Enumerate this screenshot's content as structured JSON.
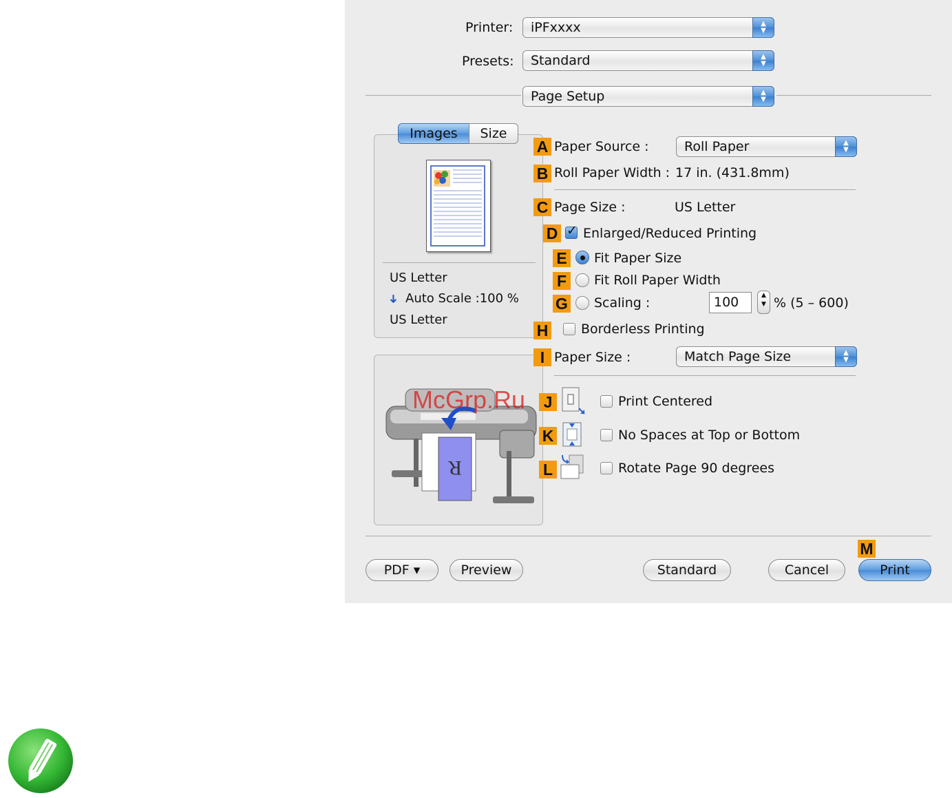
{
  "header": {
    "printer_label": "Printer:",
    "printer_value": "iPFxxxx",
    "presets_label": "Presets:",
    "presets_value": "Standard",
    "panel_value": "Page Setup"
  },
  "tabs": [
    {
      "label": "Images",
      "active": true
    },
    {
      "label": "Size",
      "active": false
    }
  ],
  "preview_info": {
    "line1": "US Letter",
    "scale_arrow": "➜",
    "line2": "Auto Scale :100 %",
    "line3": "US Letter"
  },
  "markers": [
    "A",
    "B",
    "C",
    "D",
    "E",
    "F",
    "G",
    "H",
    "I",
    "J",
    "K",
    "L",
    "M"
  ],
  "settings": {
    "paper_source_label": "Paper Source :",
    "paper_source_value": "Roll Paper",
    "roll_width_label": "Roll Paper Width :",
    "roll_width_value": "17 in. (431.8mm)",
    "page_size_label": "Page Size :",
    "page_size_value": "US Letter",
    "enlarged_label": "Enlarged/Reduced Printing",
    "enlarged_checked": true,
    "fit_paper_label": "Fit Paper Size",
    "fit_roll_label": "Fit Roll Paper Width",
    "scaling_label": "Scaling :",
    "scaling_value": "100",
    "scaling_range": "% (5 – 600)",
    "borderless_label": "Borderless Printing",
    "paper_size_label": "Paper Size :",
    "paper_size_value": "Match Page Size",
    "print_centered_label": "Print Centered",
    "no_spaces_label": "No Spaces at Top or Bottom",
    "rotate_label": "Rotate Page 90 degrees"
  },
  "watermark": "McGrp.Ru",
  "footer": {
    "pdf_label": "PDF ▾",
    "preview_label": "Preview",
    "standard_label": "Standard",
    "cancel_label": "Cancel",
    "print_label": "Print"
  },
  "colors": {
    "accent": "#3e85d4",
    "marker": "#f39b10",
    "note_icon": "#33b633"
  },
  "icons": [
    "updown-arrows-icon",
    "page-preview-icon",
    "printer-illustration",
    "print-centered-icon",
    "no-spaces-icon",
    "rotate-page-icon",
    "note-pencil-icon"
  ]
}
